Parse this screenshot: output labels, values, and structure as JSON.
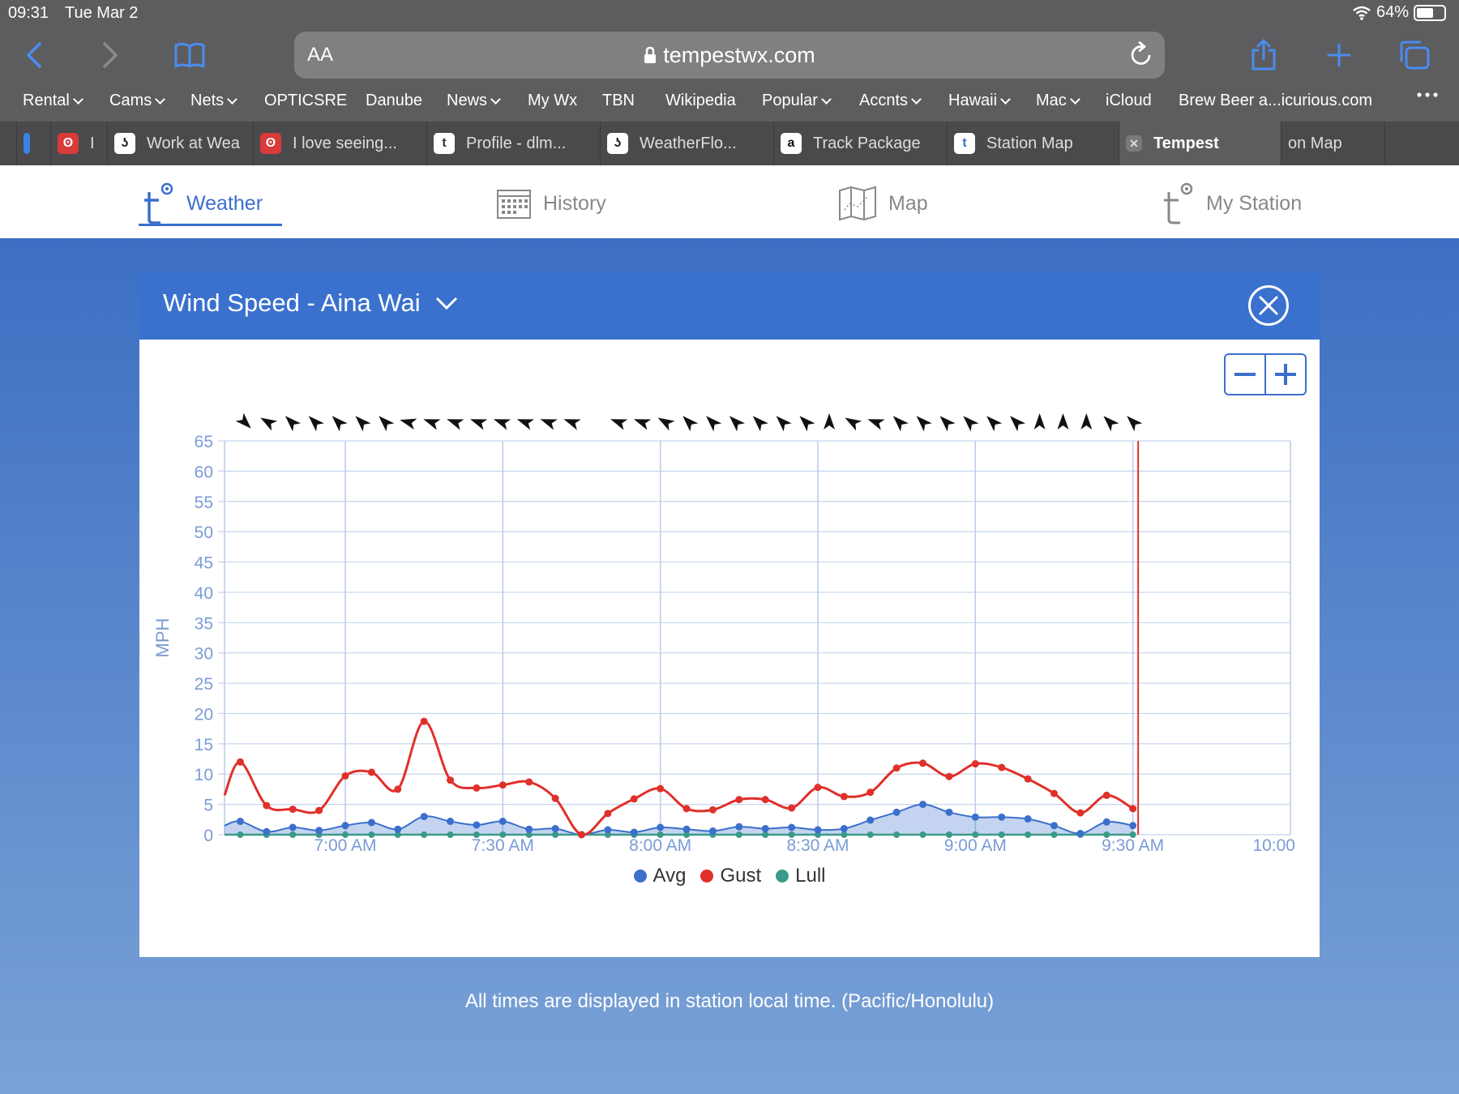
{
  "status": {
    "time": "09:31",
    "date": "Tue Mar 2",
    "battery": "64%",
    "battery_level": 0.64
  },
  "browser": {
    "url_aa": "AA",
    "url": "tempestwx.com",
    "bookmarks": [
      {
        "label": "Rental",
        "dropdown": true
      },
      {
        "label": "Cams",
        "dropdown": true
      },
      {
        "label": "Nets",
        "dropdown": true
      },
      {
        "label": "OPTICSRE",
        "dropdown": false
      },
      {
        "label": "Danube",
        "dropdown": false
      },
      {
        "label": "News",
        "dropdown": true
      },
      {
        "label": "My Wx",
        "dropdown": false
      },
      {
        "label": "TBN",
        "dropdown": false
      },
      {
        "label": "Wikipedia",
        "dropdown": false
      },
      {
        "label": "Popular",
        "dropdown": true
      },
      {
        "label": "Accnts",
        "dropdown": true
      },
      {
        "label": "Hawaii",
        "dropdown": true
      },
      {
        "label": "Mac",
        "dropdown": true
      },
      {
        "label": "iCloud",
        "dropdown": false
      },
      {
        "label": "Brew Beer a...icurious.com",
        "dropdown": false
      }
    ],
    "tabs": [
      {
        "label": "",
        "icon": "blue-tab-icon"
      },
      {
        "label": "I",
        "icon": "red-app-icon"
      },
      {
        "label": "Work at Wea",
        "icon": "weatherflow-icon"
      },
      {
        "label": "I love seeing...",
        "icon": "red-app-icon"
      },
      {
        "label": "Profile - dlm...",
        "icon": "tempest-icon"
      },
      {
        "label": "WeatherFlo...",
        "icon": "weatherflow-icon"
      },
      {
        "label": "Track Package",
        "icon": "amazon-icon"
      },
      {
        "label": "Station Map",
        "icon": "tempest-blue-icon"
      },
      {
        "label": "Tempest",
        "icon": "close-icon",
        "active": true
      },
      {
        "label": "on Map",
        "icon": ""
      }
    ]
  },
  "nav": {
    "items": [
      {
        "label": "Weather",
        "icon": "tempest-logo-icon",
        "active": true
      },
      {
        "label": "History",
        "icon": "calendar-icon"
      },
      {
        "label": "Map",
        "icon": "map-icon"
      },
      {
        "label": "My Station",
        "icon": "tempest-logo-icon"
      }
    ]
  },
  "panel": {
    "title": "Wind Speed - Aina Wai"
  },
  "chart_data": {
    "type": "line",
    "ylabel": "MPH",
    "ylim": [
      0,
      65
    ],
    "yticks": [
      "65",
      "60",
      "55",
      "50",
      "45",
      "40",
      "35",
      "30",
      "25",
      "20",
      "15",
      "10",
      "5",
      "0"
    ],
    "xlim": [
      "6:37 AM",
      "10:00 AM"
    ],
    "xticks": [
      "7:00 AM",
      "7:30 AM",
      "8:00 AM",
      "8:30 AM",
      "9:00 AM",
      "9:30 AM",
      "10:00"
    ],
    "grid": true,
    "legend_position": "bottom",
    "current_time_marker": "9:31 AM",
    "x_times": [
      "6:37",
      "6:40",
      "6:45",
      "6:50",
      "6:55",
      "7:00",
      "7:05",
      "7:10",
      "7:15",
      "7:20",
      "7:25",
      "7:30",
      "7:35",
      "7:40",
      "7:45",
      "7:50",
      "7:55",
      "8:00",
      "8:05",
      "8:10",
      "8:15",
      "8:20",
      "8:25",
      "8:30",
      "8:35",
      "8:40",
      "8:45",
      "8:50",
      "8:55",
      "9:00",
      "9:05",
      "9:10",
      "9:15",
      "9:20",
      "9:25",
      "9:30"
    ],
    "series": [
      {
        "name": "Avg",
        "color": "#3b6fcc",
        "values": [
          1.5,
          2.2,
          0.5,
          1.2,
          0.7,
          1.5,
          2.0,
          0.9,
          3.0,
          2.2,
          1.6,
          2.2,
          0.9,
          1.0,
          0.0,
          0.8,
          0.4,
          1.2,
          0.9,
          0.6,
          1.3,
          1.0,
          1.2,
          0.8,
          1.0,
          2.4,
          3.7,
          5.0,
          3.7,
          2.9,
          2.9,
          2.6,
          1.5,
          0.2,
          2.1,
          1.5
        ]
      },
      {
        "name": "Gust",
        "color": "#e0302a",
        "values": [
          6.5,
          12.0,
          4.8,
          4.2,
          4.0,
          9.7,
          10.3,
          7.5,
          18.7,
          9.0,
          7.7,
          8.2,
          8.7,
          6.0,
          0.0,
          3.5,
          5.9,
          7.6,
          4.3,
          4.1,
          5.8,
          5.8,
          4.4,
          7.8,
          6.3,
          7.0,
          11.0,
          11.8,
          9.6,
          11.7,
          11.1,
          9.2,
          6.8,
          3.6,
          6.5,
          4.3
        ]
      },
      {
        "name": "Lull",
        "color": "#3a9a8a",
        "values": [
          0,
          0,
          0,
          0,
          0,
          0,
          0,
          0,
          0,
          0,
          0,
          0,
          0,
          0,
          0,
          0,
          0,
          0,
          0,
          0,
          0,
          0,
          0,
          0,
          0,
          0,
          0,
          0,
          0,
          0,
          0,
          0,
          0,
          0,
          0,
          0
        ]
      }
    ],
    "wind_direction_deg": [
      135,
      300,
      315,
      315,
      315,
      315,
      315,
      285,
      290,
      290,
      290,
      290,
      290,
      290,
      290,
      null,
      290,
      290,
      300,
      315,
      315,
      315,
      315,
      315,
      315,
      0,
      300,
      290,
      315,
      315,
      315,
      315,
      315,
      315,
      0,
      0,
      0,
      315,
      315
    ]
  },
  "footnote": "All times are displayed in station local time. (Pacific/Honolulu)"
}
